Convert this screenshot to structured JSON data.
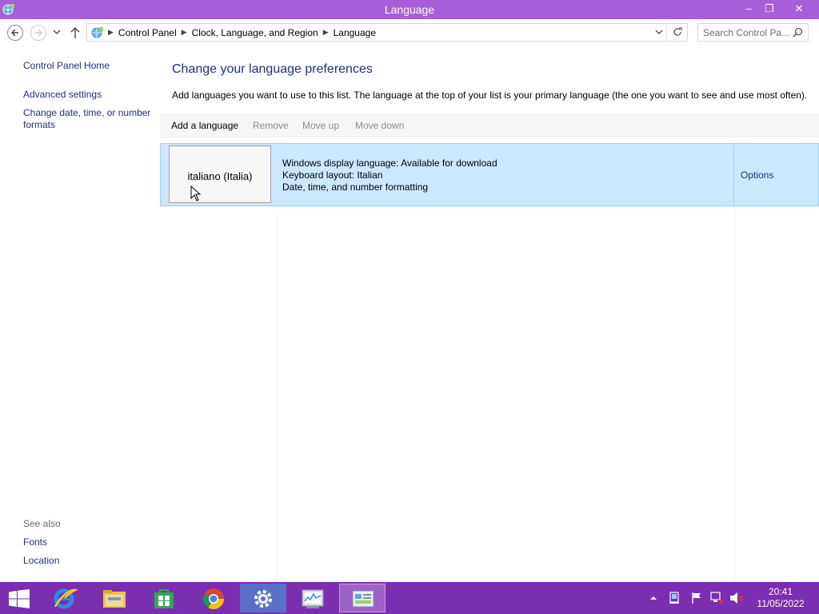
{
  "window": {
    "title": "Language",
    "controls": {
      "minimize": "–",
      "maximize": "❐",
      "close": "✕"
    }
  },
  "address": {
    "crumbs": [
      "Control Panel",
      "Clock, Language, and Region",
      "Language"
    ],
    "search_placeholder": "Search Control Pa..."
  },
  "sidebar": {
    "home": "Control Panel Home",
    "links": [
      "Advanced settings",
      "Change date, time, or number formats"
    ],
    "see_also_label": "See also",
    "see_also": [
      "Fonts",
      "Location"
    ]
  },
  "main": {
    "heading": "Change your language preferences",
    "description": "Add languages you want to use to this list. The language at the top of your list is your primary language (the one you want to see and use most often).",
    "toolbar": {
      "add": "Add a language",
      "remove": "Remove",
      "move_up": "Move up",
      "move_down": "Move down"
    },
    "languages": [
      {
        "name": "italiano (Italia)",
        "display": "Windows display language: Available for download",
        "keyboard": "Keyboard layout: Italian",
        "formatting": "Date, time, and number formatting",
        "options": "Options"
      }
    ]
  },
  "taskbar": {
    "apps": [
      "internet-explorer",
      "file-explorer",
      "store",
      "chrome",
      "settings",
      "task-manager",
      "control-panel"
    ],
    "active_app": "control-panel",
    "time": "20:41",
    "date": "11/05/2022"
  },
  "colors": {
    "titlebar": "#a75ed9",
    "taskbar": "#7b2fb0",
    "link": "#1e3287",
    "selection": "#cce8ff"
  }
}
